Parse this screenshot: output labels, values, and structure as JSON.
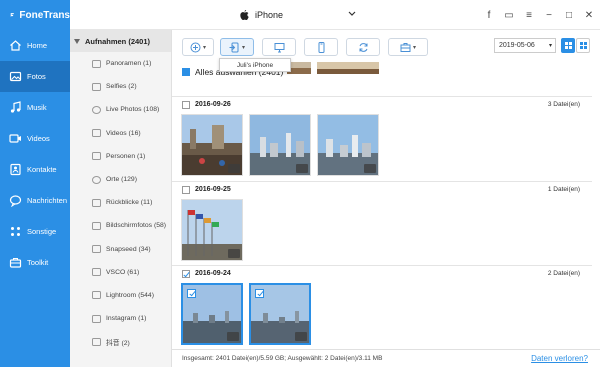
{
  "app": {
    "name": "FoneTrans",
    "device": "iPhone"
  },
  "nav": [
    {
      "label": "Home",
      "icon": "home-icon"
    },
    {
      "label": "Fotos",
      "icon": "photo-icon"
    },
    {
      "label": "Musik",
      "icon": "music-icon"
    },
    {
      "label": "Videos",
      "icon": "video-icon"
    },
    {
      "label": "Kontakte",
      "icon": "contacts-icon"
    },
    {
      "label": "Nachrichten",
      "icon": "messages-icon"
    },
    {
      "label": "Sonstige",
      "icon": "others-icon"
    },
    {
      "label": "Toolkit",
      "icon": "toolkit-icon"
    }
  ],
  "albums": {
    "header": "Aufnahmen (2401)",
    "items": [
      "Panoramen (1)",
      "Selfies (2)",
      "Live Photos (108)",
      "Videos (16)",
      "Personen (1)",
      "Orte (129)",
      "Rückblicke (11)",
      "Bildschirmfotos (58)",
      "Snapseed (34)",
      "VSCO (61)",
      "Lightroom (544)",
      "Instagram (1)",
      "抖音 (2)"
    ]
  },
  "toolbar": {
    "popup": "Juli's iPhone",
    "date": "2019-05-06"
  },
  "content": {
    "select_all": "Alles auswählen (2401)",
    "groups": [
      {
        "date": "2016-09-26",
        "count": "3 Datei(en)"
      },
      {
        "date": "2016-09-25",
        "count": "1 Datei(en)"
      },
      {
        "date": "2016-09-24",
        "count": "2 Datei(en)"
      }
    ]
  },
  "status": {
    "text": "Insgesamt: 2401 Datei(en)/5.59 GB; Ausgewählt: 2 Datei(en)/3.11 MB",
    "link": "Daten verloren?"
  },
  "colors": {
    "accent": "#2b8fe5",
    "nav_active": "#1f73c0"
  }
}
